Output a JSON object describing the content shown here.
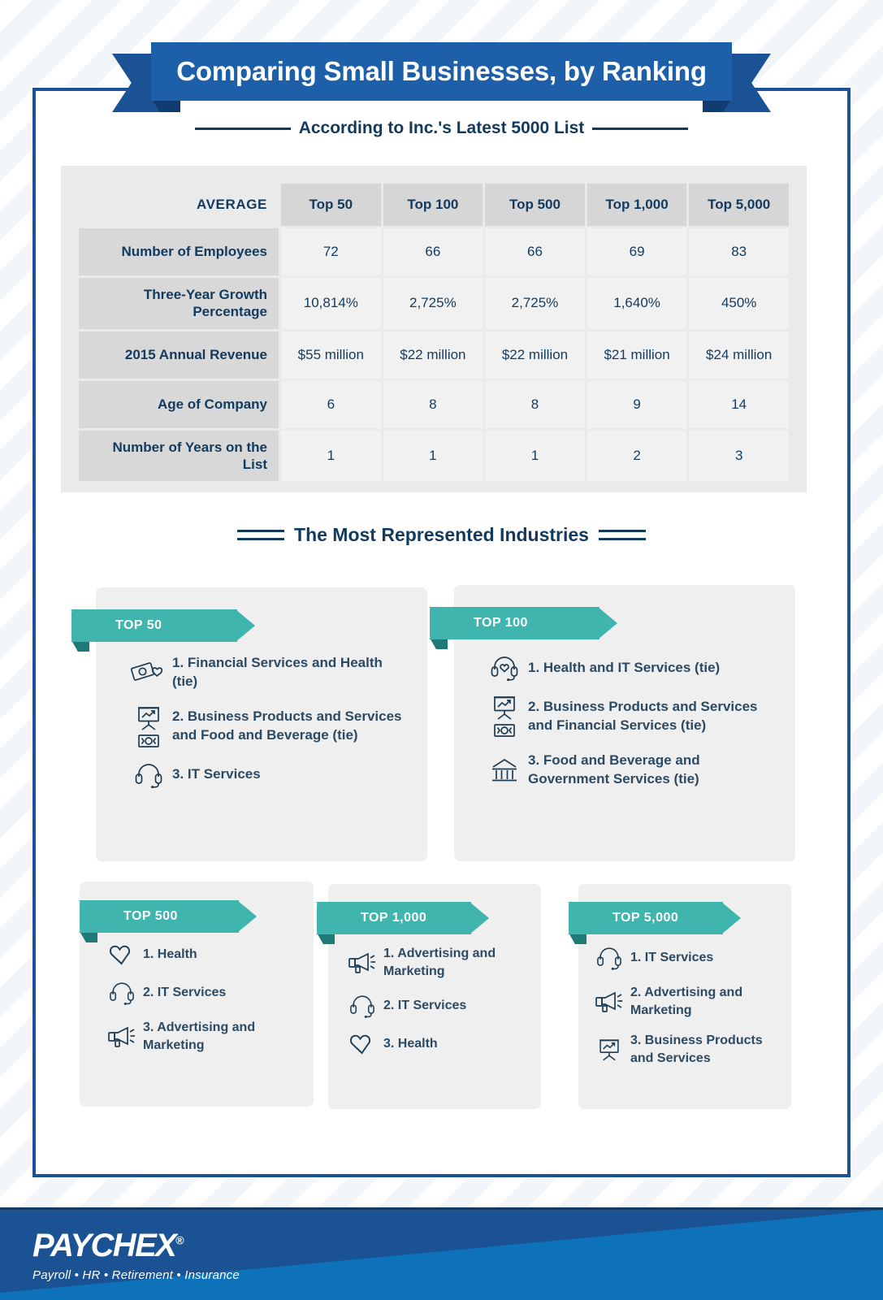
{
  "header": {
    "title": "Comparing Small Businesses, by Ranking",
    "subtitle": "According to Inc.'s Latest 5000 List"
  },
  "table": {
    "corner_label": "AVERAGE",
    "columns": [
      "Top 50",
      "Top 100",
      "Top 500",
      "Top 1,000",
      "Top 5,000"
    ],
    "rows": [
      {
        "label": "Number of Employees",
        "values": [
          "72",
          "66",
          "66",
          "69",
          "83"
        ]
      },
      {
        "label": "Three-Year Growth Percentage",
        "values": [
          "10,814%",
          "2,725%",
          "2,725%",
          "1,640%",
          "450%"
        ]
      },
      {
        "label": "2015 Annual Revenue",
        "values": [
          "$55 million",
          "$22 million",
          "$22 million",
          "$21 million",
          "$24 million"
        ]
      },
      {
        "label": "Age of Company",
        "values": [
          "6",
          "8",
          "8",
          "9",
          "14"
        ]
      },
      {
        "label": "Number of Years on the List",
        "values": [
          "1",
          "1",
          "1",
          "2",
          "3"
        ]
      }
    ]
  },
  "industries": {
    "section_title": "The Most Represented Industries",
    "groups": [
      {
        "tab": "TOP 50",
        "items": [
          {
            "icon": "money-heart-icon",
            "text": "1. Financial Services and Health (tie)"
          },
          {
            "icon": "presentation-chart-and-money-icon",
            "text": "2. Business Products and Services and Food and Beverage (tie)"
          },
          {
            "icon": "headset-icon",
            "text": "3. IT Services"
          }
        ]
      },
      {
        "tab": "TOP 100",
        "items": [
          {
            "icon": "headset-heart-icon",
            "text": "1. Health and  IT Services (tie)"
          },
          {
            "icon": "presentation-chart-and-money-icon",
            "text": "2. Business Products and Services and Financial Services (tie)"
          },
          {
            "icon": "government-building-icon",
            "text": "3. Food and Beverage and Government Services (tie)"
          }
        ]
      },
      {
        "tab": "TOP 500",
        "items": [
          {
            "icon": "heart-icon",
            "text": "1. Health"
          },
          {
            "icon": "headset-icon",
            "text": "2. IT Services"
          },
          {
            "icon": "megaphone-icon",
            "text": "3. Advertising and Marketing"
          }
        ]
      },
      {
        "tab": "TOP 1,000",
        "items": [
          {
            "icon": "megaphone-icon",
            "text": "1. Advertising and Marketing"
          },
          {
            "icon": "headset-icon",
            "text": "2. IT Services"
          },
          {
            "icon": "heart-icon",
            "text": "3. Health"
          }
        ]
      },
      {
        "tab": "TOP 5,000",
        "items": [
          {
            "icon": "headset-icon",
            "text": "1. IT Services"
          },
          {
            "icon": "megaphone-icon",
            "text": "2. Advertising and Marketing"
          },
          {
            "icon": "presentation-chart-icon",
            "text": "3. Business Products and Services"
          }
        ]
      }
    ]
  },
  "footer": {
    "brand": "PAYCHEX",
    "trademark": "®",
    "tagline": "Payroll • HR • Retirement • Insurance"
  },
  "colors": {
    "brand_blue": "#1a5294",
    "ribbon_blue": "#1d5fa8",
    "dark_navy": "#123a5e",
    "teal": "#3fb5ad",
    "footer_light_blue": "#0d72ba",
    "panel_gray": "#eaeaea",
    "card_gray": "#efefef"
  }
}
